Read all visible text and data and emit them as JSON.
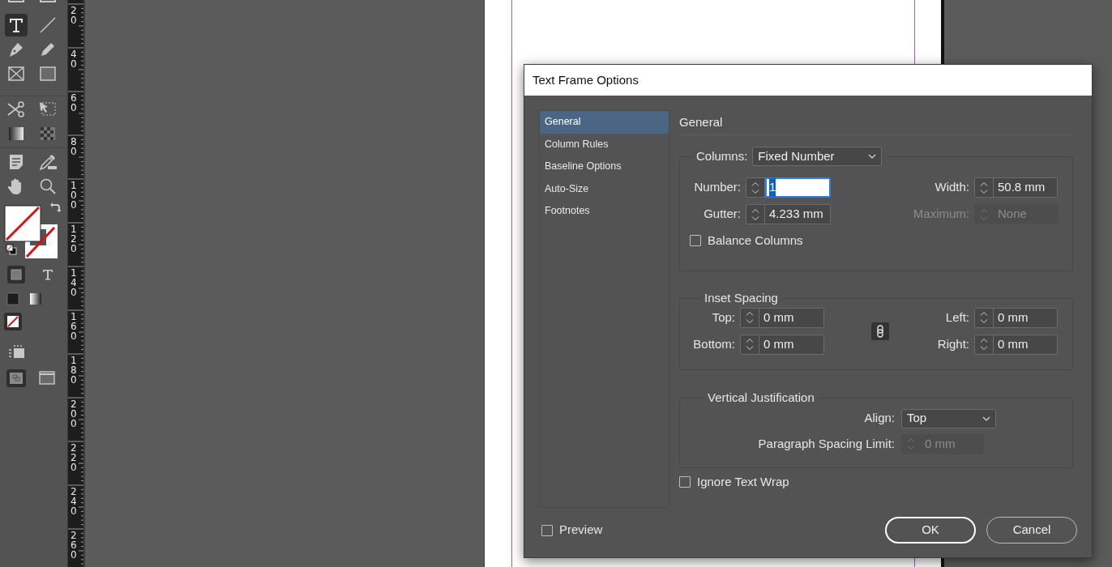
{
  "toolbar": {
    "groups": [
      {
        "tools": [
          {
            "kind": "cut-box",
            "selected": false
          },
          {
            "kind": "cut-box",
            "selected": false
          },
          {
            "kind": "type",
            "selected": true
          },
          {
            "kind": "line",
            "selected": false
          },
          {
            "kind": "pen",
            "selected": false
          },
          {
            "kind": "pencil",
            "selected": false
          },
          {
            "kind": "frame",
            "selected": false
          },
          {
            "kind": "rectangle",
            "selected": false
          }
        ]
      },
      {
        "tools": [
          {
            "kind": "scissors",
            "selected": false
          },
          {
            "kind": "transform",
            "selected": false
          },
          {
            "kind": "gradient",
            "selected": false
          },
          {
            "kind": "feather",
            "selected": false
          }
        ]
      },
      {
        "tools": [
          {
            "kind": "note",
            "selected": false
          },
          {
            "kind": "eyedropper",
            "selected": false
          },
          {
            "kind": "hand",
            "selected": false
          },
          {
            "kind": "zoom",
            "selected": false
          }
        ]
      },
      {
        "tools": [
          {
            "kind": "swatch"
          }
        ]
      },
      {
        "tools": [
          {
            "kind": "container",
            "selected": true
          },
          {
            "kind": "text",
            "selected": false
          }
        ]
      },
      {
        "tools": [
          {
            "kind": "color",
            "selected": false
          },
          {
            "kind": "gradient-fill",
            "selected": false
          },
          {
            "kind": "none",
            "selected": true
          }
        ]
      },
      {
        "tools": [
          {
            "kind": "frames",
            "selected": false
          }
        ]
      },
      {
        "tools": [
          {
            "kind": "screen",
            "selected": true
          },
          {
            "kind": "window",
            "selected": false
          }
        ]
      }
    ]
  },
  "ruler": {
    "labels": [
      "20",
      "40",
      "60",
      "80",
      "100",
      "120",
      "140",
      "160",
      "180",
      "200",
      "220",
      "240",
      "260"
    ]
  },
  "dialog": {
    "title": "Text Frame Options",
    "sections": [
      {
        "label": "General",
        "selected": true
      },
      {
        "label": "Column Rules",
        "selected": false
      },
      {
        "label": "Baseline Options",
        "selected": false
      },
      {
        "label": "Auto-Size",
        "selected": false
      },
      {
        "label": "Footnotes",
        "selected": false
      }
    ],
    "heading": "General",
    "columns": {
      "label": "Columns:",
      "value": "Fixed Number",
      "fields": [
        {
          "label": "Number:",
          "value": "1",
          "focused": true,
          "disabled": false
        },
        {
          "label": "Width:",
          "value": "50.8 mm",
          "focused": false,
          "disabled": false
        },
        {
          "label": "Gutter:",
          "value": "4.233 mm",
          "focused": false,
          "disabled": false
        },
        {
          "label": "Maximum:",
          "value": "None",
          "focused": false,
          "disabled": true
        }
      ],
      "balance": {
        "label": "Balance Columns",
        "checked": false
      }
    },
    "inset": {
      "title": "Inset Spacing",
      "fields": [
        {
          "label": "Top:",
          "value": "0 mm"
        },
        {
          "label": "Left:",
          "value": "0 mm"
        },
        {
          "label": "Bottom:",
          "value": "0 mm"
        },
        {
          "label": "Right:",
          "value": "0 mm"
        }
      ]
    },
    "vertical": {
      "title": "Vertical Justification",
      "align": {
        "label": "Align:",
        "value": "Top"
      },
      "spacing_limit": {
        "label": "Paragraph Spacing Limit:",
        "value": "0 mm",
        "disabled": true
      }
    },
    "ignore_wrap": {
      "label": "Ignore Text Wrap",
      "checked": false
    },
    "preview": {
      "label": "Preview",
      "checked": false
    },
    "buttons": [
      {
        "label": "OK",
        "kind": "primary"
      },
      {
        "label": "Cancel",
        "kind": "secondary"
      }
    ]
  }
}
